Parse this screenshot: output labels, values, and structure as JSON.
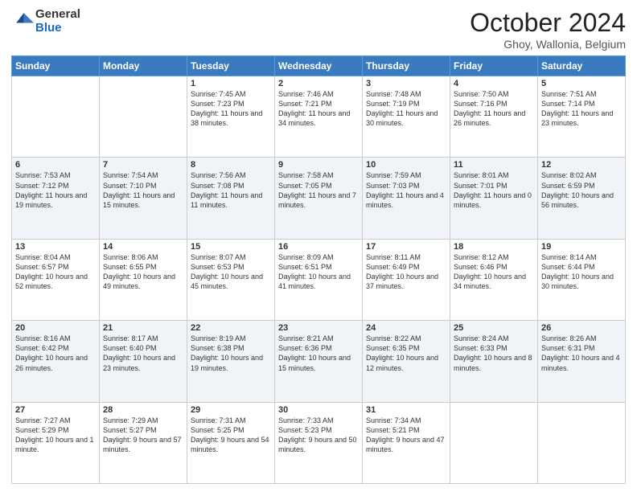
{
  "logo": {
    "general": "General",
    "blue": "Blue"
  },
  "header": {
    "month": "October 2024",
    "location": "Ghoy, Wallonia, Belgium"
  },
  "days_of_week": [
    "Sunday",
    "Monday",
    "Tuesday",
    "Wednesday",
    "Thursday",
    "Friday",
    "Saturday"
  ],
  "weeks": [
    [
      {
        "day": "",
        "sunrise": "",
        "sunset": "",
        "daylight": ""
      },
      {
        "day": "",
        "sunrise": "",
        "sunset": "",
        "daylight": ""
      },
      {
        "day": "1",
        "sunrise": "Sunrise: 7:45 AM",
        "sunset": "Sunset: 7:23 PM",
        "daylight": "Daylight: 11 hours and 38 minutes."
      },
      {
        "day": "2",
        "sunrise": "Sunrise: 7:46 AM",
        "sunset": "Sunset: 7:21 PM",
        "daylight": "Daylight: 11 hours and 34 minutes."
      },
      {
        "day": "3",
        "sunrise": "Sunrise: 7:48 AM",
        "sunset": "Sunset: 7:19 PM",
        "daylight": "Daylight: 11 hours and 30 minutes."
      },
      {
        "day": "4",
        "sunrise": "Sunrise: 7:50 AM",
        "sunset": "Sunset: 7:16 PM",
        "daylight": "Daylight: 11 hours and 26 minutes."
      },
      {
        "day": "5",
        "sunrise": "Sunrise: 7:51 AM",
        "sunset": "Sunset: 7:14 PM",
        "daylight": "Daylight: 11 hours and 23 minutes."
      }
    ],
    [
      {
        "day": "6",
        "sunrise": "Sunrise: 7:53 AM",
        "sunset": "Sunset: 7:12 PM",
        "daylight": "Daylight: 11 hours and 19 minutes."
      },
      {
        "day": "7",
        "sunrise": "Sunrise: 7:54 AM",
        "sunset": "Sunset: 7:10 PM",
        "daylight": "Daylight: 11 hours and 15 minutes."
      },
      {
        "day": "8",
        "sunrise": "Sunrise: 7:56 AM",
        "sunset": "Sunset: 7:08 PM",
        "daylight": "Daylight: 11 hours and 11 minutes."
      },
      {
        "day": "9",
        "sunrise": "Sunrise: 7:58 AM",
        "sunset": "Sunset: 7:05 PM",
        "daylight": "Daylight: 11 hours and 7 minutes."
      },
      {
        "day": "10",
        "sunrise": "Sunrise: 7:59 AM",
        "sunset": "Sunset: 7:03 PM",
        "daylight": "Daylight: 11 hours and 4 minutes."
      },
      {
        "day": "11",
        "sunrise": "Sunrise: 8:01 AM",
        "sunset": "Sunset: 7:01 PM",
        "daylight": "Daylight: 11 hours and 0 minutes."
      },
      {
        "day": "12",
        "sunrise": "Sunrise: 8:02 AM",
        "sunset": "Sunset: 6:59 PM",
        "daylight": "Daylight: 10 hours and 56 minutes."
      }
    ],
    [
      {
        "day": "13",
        "sunrise": "Sunrise: 8:04 AM",
        "sunset": "Sunset: 6:57 PM",
        "daylight": "Daylight: 10 hours and 52 minutes."
      },
      {
        "day": "14",
        "sunrise": "Sunrise: 8:06 AM",
        "sunset": "Sunset: 6:55 PM",
        "daylight": "Daylight: 10 hours and 49 minutes."
      },
      {
        "day": "15",
        "sunrise": "Sunrise: 8:07 AM",
        "sunset": "Sunset: 6:53 PM",
        "daylight": "Daylight: 10 hours and 45 minutes."
      },
      {
        "day": "16",
        "sunrise": "Sunrise: 8:09 AM",
        "sunset": "Sunset: 6:51 PM",
        "daylight": "Daylight: 10 hours and 41 minutes."
      },
      {
        "day": "17",
        "sunrise": "Sunrise: 8:11 AM",
        "sunset": "Sunset: 6:49 PM",
        "daylight": "Daylight: 10 hours and 37 minutes."
      },
      {
        "day": "18",
        "sunrise": "Sunrise: 8:12 AM",
        "sunset": "Sunset: 6:46 PM",
        "daylight": "Daylight: 10 hours and 34 minutes."
      },
      {
        "day": "19",
        "sunrise": "Sunrise: 8:14 AM",
        "sunset": "Sunset: 6:44 PM",
        "daylight": "Daylight: 10 hours and 30 minutes."
      }
    ],
    [
      {
        "day": "20",
        "sunrise": "Sunrise: 8:16 AM",
        "sunset": "Sunset: 6:42 PM",
        "daylight": "Daylight: 10 hours and 26 minutes."
      },
      {
        "day": "21",
        "sunrise": "Sunrise: 8:17 AM",
        "sunset": "Sunset: 6:40 PM",
        "daylight": "Daylight: 10 hours and 23 minutes."
      },
      {
        "day": "22",
        "sunrise": "Sunrise: 8:19 AM",
        "sunset": "Sunset: 6:38 PM",
        "daylight": "Daylight: 10 hours and 19 minutes."
      },
      {
        "day": "23",
        "sunrise": "Sunrise: 8:21 AM",
        "sunset": "Sunset: 6:36 PM",
        "daylight": "Daylight: 10 hours and 15 minutes."
      },
      {
        "day": "24",
        "sunrise": "Sunrise: 8:22 AM",
        "sunset": "Sunset: 6:35 PM",
        "daylight": "Daylight: 10 hours and 12 minutes."
      },
      {
        "day": "25",
        "sunrise": "Sunrise: 8:24 AM",
        "sunset": "Sunset: 6:33 PM",
        "daylight": "Daylight: 10 hours and 8 minutes."
      },
      {
        "day": "26",
        "sunrise": "Sunrise: 8:26 AM",
        "sunset": "Sunset: 6:31 PM",
        "daylight": "Daylight: 10 hours and 4 minutes."
      }
    ],
    [
      {
        "day": "27",
        "sunrise": "Sunrise: 7:27 AM",
        "sunset": "Sunset: 5:29 PM",
        "daylight": "Daylight: 10 hours and 1 minute."
      },
      {
        "day": "28",
        "sunrise": "Sunrise: 7:29 AM",
        "sunset": "Sunset: 5:27 PM",
        "daylight": "Daylight: 9 hours and 57 minutes."
      },
      {
        "day": "29",
        "sunrise": "Sunrise: 7:31 AM",
        "sunset": "Sunset: 5:25 PM",
        "daylight": "Daylight: 9 hours and 54 minutes."
      },
      {
        "day": "30",
        "sunrise": "Sunrise: 7:33 AM",
        "sunset": "Sunset: 5:23 PM",
        "daylight": "Daylight: 9 hours and 50 minutes."
      },
      {
        "day": "31",
        "sunrise": "Sunrise: 7:34 AM",
        "sunset": "Sunset: 5:21 PM",
        "daylight": "Daylight: 9 hours and 47 minutes."
      },
      {
        "day": "",
        "sunrise": "",
        "sunset": "",
        "daylight": ""
      },
      {
        "day": "",
        "sunrise": "",
        "sunset": "",
        "daylight": ""
      }
    ]
  ]
}
